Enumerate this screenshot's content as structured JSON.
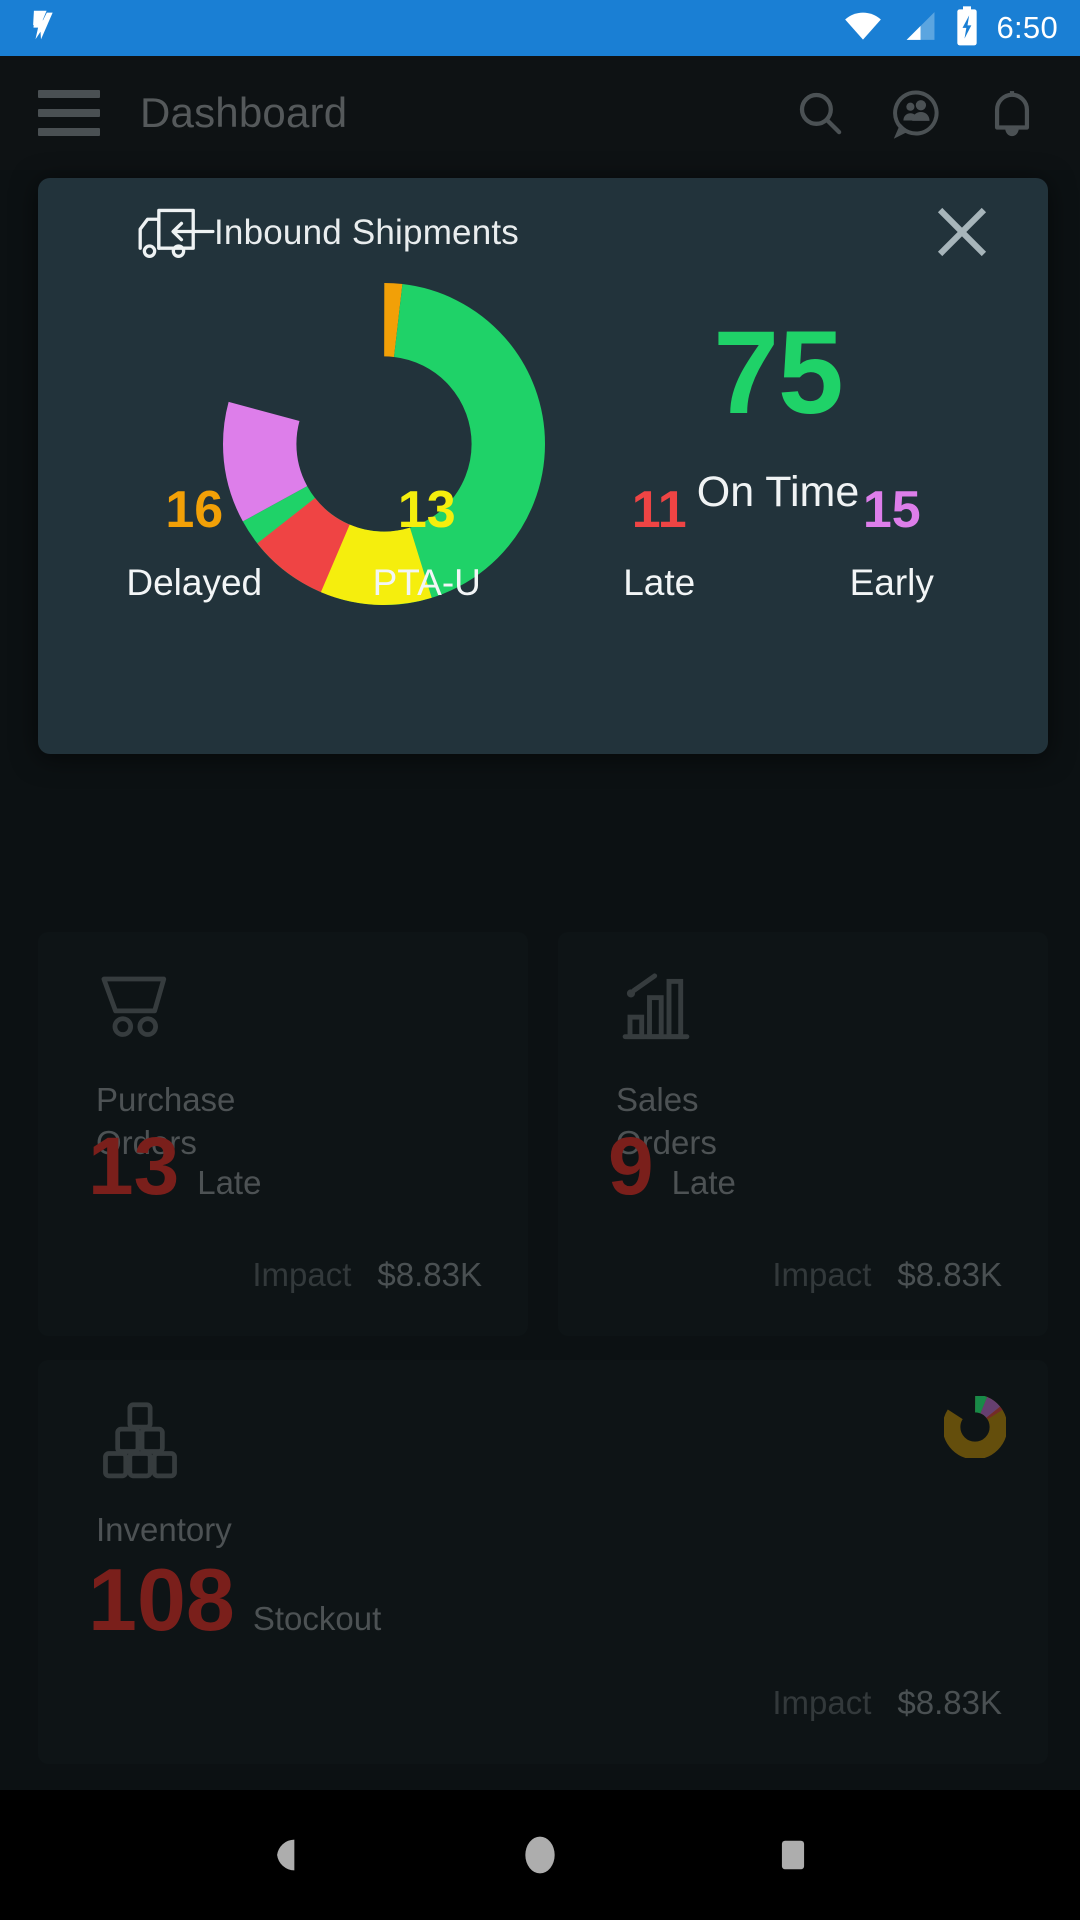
{
  "status_bar": {
    "time": "6:50",
    "icons": [
      "app-logo-icon",
      "wifi-icon",
      "cellular-signal-icon",
      "battery-charging-icon"
    ],
    "background_color": "#1a7fd4"
  },
  "app_bar": {
    "menu_icon": "hamburger-menu-icon",
    "title": "Dashboard",
    "actions": [
      {
        "icon": "search-icon",
        "label": "Search"
      },
      {
        "icon": "chat-contacts-icon",
        "label": "Messages"
      },
      {
        "icon": "notification-bell-icon",
        "label": "Notifications"
      }
    ]
  },
  "modal": {
    "icon": "inbound-truck-icon",
    "title": "Inbound Shipments",
    "close_icon": "close-icon",
    "kpi": {
      "value": "75",
      "label": "On Time",
      "color": "#1fd268"
    },
    "stats": [
      {
        "value": "16",
        "label": "Delayed",
        "color": "#f2a007"
      },
      {
        "value": "13",
        "label": "PTA-U",
        "color": "#f5ee0d"
      },
      {
        "value": "11",
        "label": "Late",
        "color": "#ef4444"
      },
      {
        "value": "15",
        "label": "Early",
        "color": "#dd7eea"
      }
    ]
  },
  "chart_data": {
    "type": "pie",
    "title": "Inbound Shipments",
    "subtitle": "On Time",
    "categories": [
      "Delayed",
      "On Time",
      "Early",
      "Late",
      "PTA-U"
    ],
    "values": [
      2,
      75,
      15,
      11,
      13
    ],
    "labels": [
      "16",
      "75",
      "15",
      "11",
      "13"
    ],
    "colors": [
      "#f2a007",
      "#1fd268",
      "#dd7eea",
      "#ef4444",
      "#f5ee0d"
    ],
    "donut": true,
    "inner_radius_ratio": 0.62,
    "start_angle_deg": -90,
    "direction": "clockwise",
    "legend": "bottom-row",
    "grid": false
  },
  "cards": [
    {
      "name": "purchase-orders",
      "icon": "shopping-cart-icon",
      "title": "Purchase\nOrders",
      "title_line1": "Purchase",
      "title_line2": "Orders",
      "metric_value": "13",
      "metric_label": "Late",
      "impact_label": "Impact",
      "impact_value": "$8.83K"
    },
    {
      "name": "sales-orders",
      "icon": "bar-chart-trend-icon",
      "title_line1": "Sales",
      "title_line2": "Orders",
      "metric_value": "9",
      "metric_label": "Late",
      "impact_label": "Impact",
      "impact_value": "$8.83K"
    },
    {
      "name": "inventory",
      "icon": "stacked-boxes-icon",
      "title_line1": "Inventory",
      "title_line2": "",
      "metric_value": "108",
      "metric_label": "Stockout",
      "impact_label": "Impact",
      "impact_value": "$8.83K",
      "mini_chart": {
        "type": "pie",
        "donut": true,
        "values": [
          84,
          6,
          8,
          2
        ],
        "colors": [
          "#9a7206",
          "#1fd268",
          "#9c5aa8",
          "#b33a33"
        ]
      }
    }
  ],
  "nav_bar": {
    "buttons": [
      {
        "icon": "back-triangle-icon",
        "label": "Back"
      },
      {
        "icon": "home-circle-icon",
        "label": "Home"
      },
      {
        "icon": "recents-square-icon",
        "label": "Recents"
      }
    ]
  }
}
